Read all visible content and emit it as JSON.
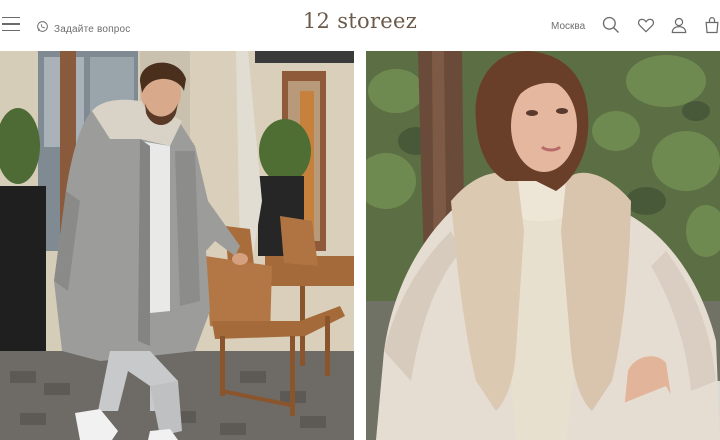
{
  "header": {
    "menu_icon": "burger-icon",
    "ask_icon": "whatsapp-icon",
    "ask_label": "Задайте вопрос",
    "logo": "12 storeez",
    "city": "Москва",
    "icons": [
      "search-icon",
      "heart-icon",
      "user-icon",
      "bag-icon"
    ]
  },
  "photos": [
    {
      "name": "man-grey-parka-cafe-photo"
    },
    {
      "name": "woman-cream-puffer-fur-collar-photo"
    }
  ],
  "colors": {
    "logo": "#6b5a4a",
    "text": "#6e6e6e",
    "icon": "#6b6b6b"
  }
}
